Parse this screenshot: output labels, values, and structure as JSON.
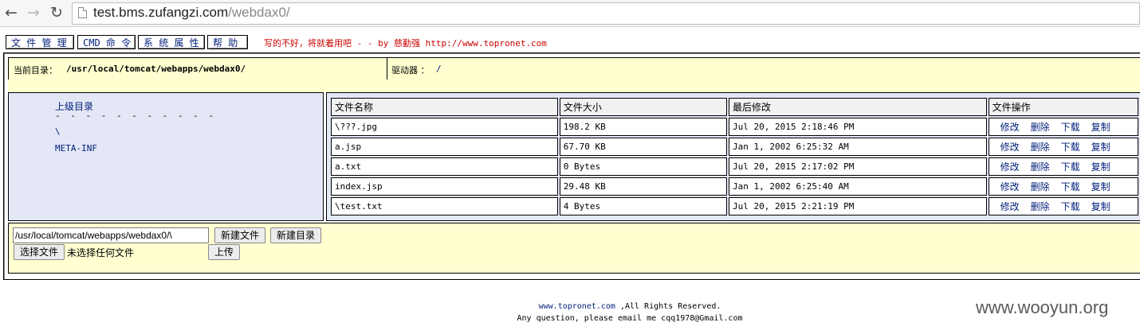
{
  "browser": {
    "url_host": "test.bms.zufangzi.com",
    "url_path": "/webdax0/"
  },
  "menu": {
    "items": [
      "文 件 管 理",
      "CMD 命 令",
      "系 统 属 性",
      "帮 助"
    ],
    "credit_text": "写的不好，将就着用吧 - - by 慈勤强 ",
    "credit_url": "http://www.topronet.com"
  },
  "dirbar": {
    "current_label": "当前目录：",
    "current_path": "/usr/local/tomcat/webapps/webdax0/",
    "drive_label": "驱动器 ：",
    "drive_value": "/"
  },
  "tree": {
    "parent_label": "上级目录",
    "dashes": "- - - - - - - - - - -",
    "items": [
      "\\",
      "META-INF"
    ]
  },
  "table": {
    "headers": [
      "文件名称",
      "文件大小",
      "最后修改",
      "文件操作"
    ],
    "rows": [
      {
        "name": "\\???.jpg",
        "size": "198.2 KB",
        "modified": "Jul 20, 2015 2:18:46 PM"
      },
      {
        "name": "a.jsp",
        "size": "67.70 KB",
        "modified": "Jan 1, 2002 6:25:32 AM"
      },
      {
        "name": "a.txt",
        "size": "0 Bytes",
        "modified": "Jul 20, 2015 2:17:02 PM"
      },
      {
        "name": "index.jsp",
        "size": "29.48 KB",
        "modified": "Jan 1, 2002 6:25:40 AM"
      },
      {
        "name": "\\test.txt",
        "size": "4 Bytes",
        "modified": "Jul 20, 2015 2:21:19 PM"
      }
    ],
    "ops": [
      "修改",
      "删除",
      "下载",
      "复制"
    ]
  },
  "form": {
    "path_value": "/usr/local/tomcat/webapps/webdax0/\\",
    "new_file": "新建文件",
    "new_dir": "新建目录",
    "choose_file": "选择文件",
    "no_file": "未选择任何文件",
    "upload": "上传"
  },
  "footer": {
    "site": "www.topronet.com",
    "rights": " ,All Rights Reserved.",
    "contact": "Any question, please email me cqq1978@Gmail.com"
  },
  "watermark": "www.wooyun.org"
}
